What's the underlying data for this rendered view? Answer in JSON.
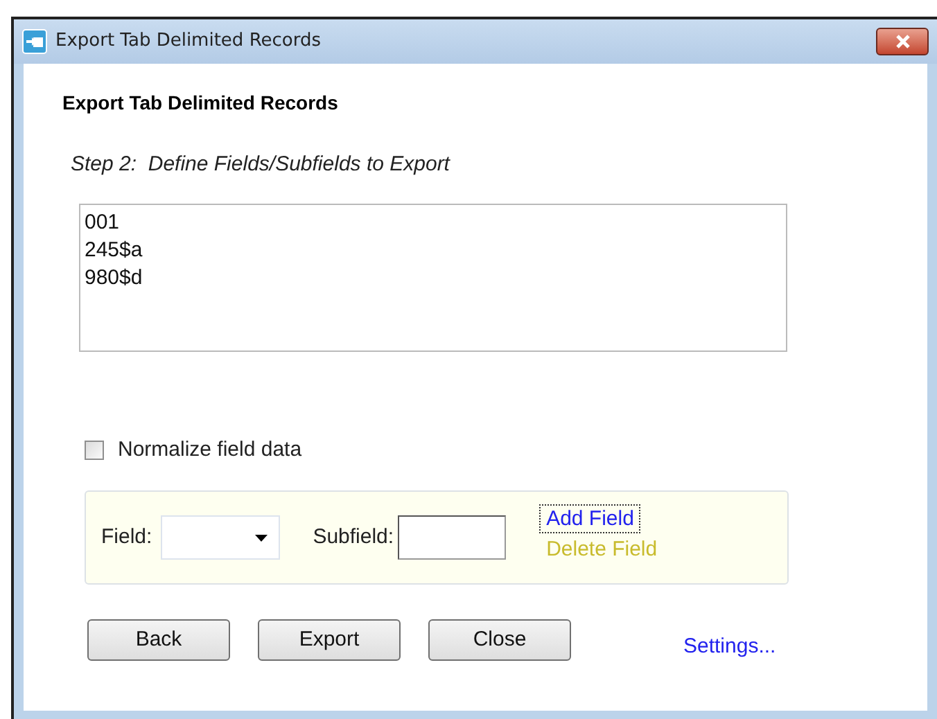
{
  "window": {
    "title": "Export Tab Delimited Records"
  },
  "heading": "Export Tab Delimited Records",
  "step": "Step 2:  Define Fields/Subfields to Export",
  "fields": [
    "001",
    "245$a",
    "980$d"
  ],
  "normalize": {
    "label": "Normalize field data",
    "checked": false
  },
  "field_editor": {
    "field_label": "Field:",
    "subfield_label": "Subfield:",
    "actions": [
      {
        "label": "Add Field",
        "focused": true,
        "disabled": false
      },
      {
        "label": "Delete Field",
        "focused": false,
        "disabled": true
      }
    ]
  },
  "buttons": [
    "Back",
    "Export",
    "Close"
  ],
  "settings_link": "Settings..."
}
